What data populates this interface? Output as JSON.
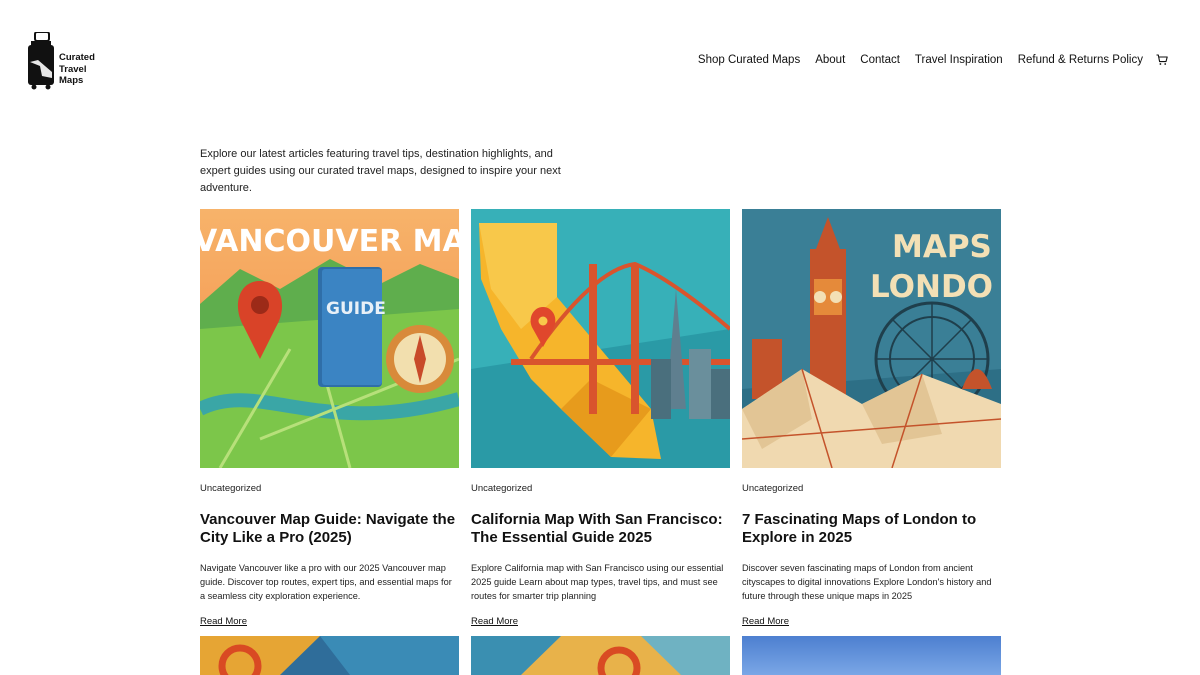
{
  "brand": {
    "line1": "Curated",
    "line2": "Travel",
    "line3": "Maps"
  },
  "nav": {
    "items": [
      "Shop Curated Maps",
      "About",
      "Contact",
      "Travel Inspiration",
      "Refund & Returns Policy"
    ],
    "cart_icon": "cart-icon"
  },
  "intro": "Explore our latest articles featuring travel tips, destination highlights, and expert guides using our curated travel maps, designed to inspire your next adventure.",
  "posts": [
    {
      "category": "Uncategorized",
      "title": "Vancouver Map Guide: Navigate the City Like a Pro (2025)",
      "excerpt": "Navigate Vancouver like a pro with our 2025 Vancouver map guide. Discover top routes, expert tips, and essential maps for a seamless city exploration experience.",
      "read_more": "Read More",
      "image_text": "VANCOUVER MAP",
      "image_book_text": "GUIDE"
    },
    {
      "category": "Uncategorized",
      "title": "California Map With San Francisco: The Essential Guide 2025",
      "excerpt": "Explore California map with San Francisco using our essential 2025 guide Learn about map types, travel tips, and must see routes for smarter trip planning",
      "read_more": "Read More"
    },
    {
      "category": "Uncategorized",
      "title": "7 Fascinating Maps of London to Explore in 2025",
      "excerpt": "Discover seven fascinating maps of London from ancient cityscapes to digital innovations Explore London's history and future through these unique maps in 2025",
      "read_more": "Read More",
      "image_text_1": "MAPS O",
      "image_text_2": "LONDO"
    }
  ],
  "colors": {
    "accent": "#111111",
    "background": "#ffffff"
  }
}
